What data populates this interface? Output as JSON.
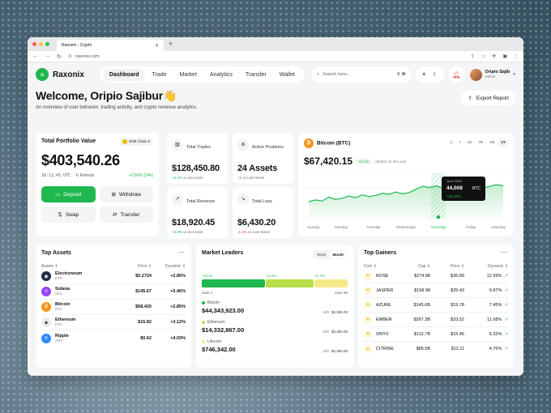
{
  "browser": {
    "tab_title": "Raxonix - Crypto",
    "url": "raxonix.com"
  },
  "nav": {
    "brand": "Raxonix",
    "items": [
      "Dashboard",
      "Trade",
      "Market",
      "Analytics",
      "Transfer",
      "Wallet"
    ],
    "active": "Dashboard",
    "search_placeholder": "Search here...",
    "search_shortcut": "K ⌘",
    "user_name": "Oripio Sajib",
    "user_role": "Admin"
  },
  "welcome": {
    "title": "Welcome, Oripio Sajibur👋",
    "subtitle": "An overview of user behavior, trading activity, and crypto revenue analytics.",
    "export_label": "Export Report"
  },
  "portfolio": {
    "title": "Total Portfolio Value",
    "chain": "BNB Chain",
    "value": "$403,540.26",
    "time": "16:12:45 UTC",
    "refresh": "Refresh",
    "change": "+2.66% (24h)",
    "buttons": [
      "Deposit",
      "Withdraw",
      "Swap",
      "Transfer"
    ]
  },
  "stats": [
    {
      "label": "Total Trades",
      "value": "$128,450.80",
      "delta": "+5.2%",
      "delta_note": "vs last week",
      "dir": "up"
    },
    {
      "label": "Active Positions",
      "value": "24 Assets",
      "delta": "+2",
      "delta_note": "vs Last Week",
      "dir": "up"
    },
    {
      "label": "Total Revenue",
      "value": "$18,920.45",
      "delta": "+3.8%",
      "delta_note": "vs last week",
      "dir": "up"
    },
    {
      "label": "Total Loss",
      "value": "$6,430.20",
      "delta": "-1.2%",
      "delta_note": "vs Last Week",
      "dir": "down"
    }
  ],
  "btc": {
    "title": "Bitcoin (BTC)",
    "price": "$67,420.15",
    "change": "+3.1%",
    "note": "+$1950.32 this year",
    "timeframes": [
      "1D",
      "7D",
      "1M",
      "1Y"
    ],
    "active_tf": "1Y",
    "tooltip_date": "June 2026",
    "tooltip_value": "44,008",
    "tooltip_unit": "BTC",
    "tooltip_change": "+23.48%"
  },
  "chart_data": {
    "type": "area",
    "x": [
      "Sunday",
      "Monday",
      "Tuesday",
      "Wednesday",
      "Thursday",
      "Friday",
      "Saturday"
    ],
    "series_points": [
      30,
      33,
      31,
      38,
      34,
      36,
      40,
      37,
      42,
      39,
      41,
      45,
      43,
      47,
      44,
      46,
      52,
      57,
      55,
      58,
      54,
      52,
      55,
      50,
      53,
      56,
      54,
      57,
      60,
      58
    ],
    "highlight_index": 4,
    "ylim": [
      0,
      80
    ]
  },
  "assets": {
    "title": "Top Assets",
    "headers": [
      "Assets",
      "Price",
      "Dynamic"
    ],
    "rows": [
      {
        "name": "Electroneum",
        "sym": "ETN",
        "price": "$0.2724",
        "dyn": "+2.85%",
        "color": "#1f2a44",
        "glyph": "◉"
      },
      {
        "name": "Solana",
        "sym": "SOL",
        "price": "$145.67",
        "dyn": "+5.46%",
        "color": "#9945ff",
        "glyph": "≡"
      },
      {
        "name": "Bitcoin",
        "sym": "BTC",
        "price": "$68,420",
        "dyn": "+2.85%",
        "color": "#f7931a",
        "glyph": "₿"
      },
      {
        "name": "Ethereum",
        "sym": "ETH",
        "price": "$15.82",
        "dyn": "+3.12%",
        "color": "#e9ecef",
        "glyph": "◆"
      },
      {
        "name": "Ripple",
        "sym": "XRP",
        "price": "$0.62",
        "dyn": "+4.03%",
        "color": "#2a8cff",
        "glyph": "✕"
      }
    ]
  },
  "leaders": {
    "title": "Market Leaders",
    "tabs": [
      "Week",
      "Month"
    ],
    "active_tab": "Month",
    "bars": [
      {
        "pct": "+3.1%",
        "share": 0.44,
        "color": "#1eb84e"
      },
      {
        "pct": "+2.4%",
        "share": 0.33,
        "color": "#b8e04a"
      },
      {
        "pct": "+1.3%",
        "share": 0.23,
        "color": "#f4ea8a"
      }
    ],
    "date_start": "June 1",
    "date_end": "June 30",
    "items": [
      {
        "name": "Bitcoin",
        "value": "$44,343,923.00",
        "h": "24h",
        "h_val": "$2,384.00",
        "color": "#1eb84e"
      },
      {
        "name": "Ethereum",
        "value": "$14,332,867.00",
        "h": "24h",
        "h_val": "$2,384.00",
        "color": "#b8e04a"
      },
      {
        "name": "Litecoin",
        "value": "$746,342.00",
        "h": "24h",
        "h_val": "$2,384.00",
        "color": "#f4ea8a"
      }
    ]
  },
  "gainers": {
    "title": "Top Gainers",
    "headers": [
      "Coin",
      "Cap",
      "Price",
      "Dynamic"
    ],
    "rows": [
      {
        "coin": "ROSE",
        "cap": "$274.88",
        "price": "$36.89",
        "dyn": "12.99%"
      },
      {
        "coin": "JASPER",
        "cap": "$158.98",
        "price": "$25.43",
        "dyn": "9.87%"
      },
      {
        "coin": "AZURE",
        "cap": "$145.6B",
        "price": "$19.78",
        "dyn": "7.45%"
      },
      {
        "coin": "EMBER",
        "cap": "$267.3B",
        "price": "$33.52",
        "dyn": "11.68%"
      },
      {
        "coin": "ONYX",
        "cap": "$112.7B",
        "price": "$15.45",
        "dyn": "5.32%"
      },
      {
        "coin": "CITRINE",
        "cap": "$89.5B",
        "price": "$12.11",
        "dyn": "4.76%"
      }
    ]
  }
}
